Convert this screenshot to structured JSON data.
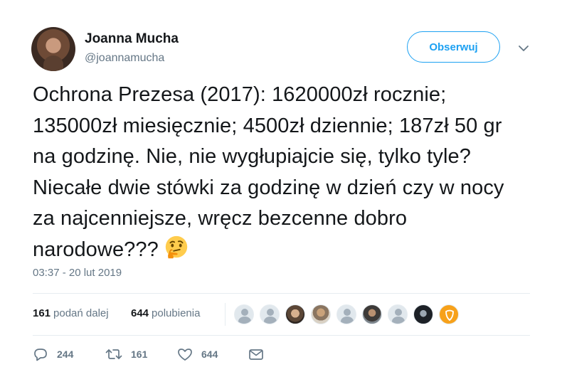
{
  "author": {
    "name": "Joanna Mucha",
    "handle": "@joannamucha"
  },
  "follow_button": {
    "label": "Obserwuj"
  },
  "tweet": {
    "text": "Ochrona Prezesa (2017): 1620000zł rocznie; 135000zł miesięcznie; 4500zł dziennie; 187zł 50 gr na godzinę. Nie, nie wygłupiajcie się, tylko tyle? Niecałe dwie stówki za godzinę w dzień czy w nocy za najcenniejsze, wręcz bezcenne dobro narodowe???",
    "emoji": "thinking-face-icon",
    "timestamp": "03:37 - 20 lut 2019"
  },
  "stats": {
    "retweets_count": "161",
    "retweets_label": "podań dalej",
    "likes_count": "644",
    "likes_label": "polubienia"
  },
  "actions": {
    "reply_count": "244",
    "retweet_count": "161",
    "like_count": "644"
  },
  "colors": {
    "accent": "#1da1f2",
    "text": "#14171a",
    "muted": "#657786",
    "border": "#e6ecf0"
  }
}
